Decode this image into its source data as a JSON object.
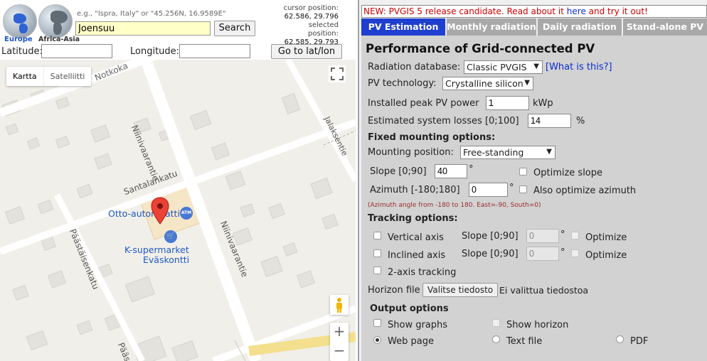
{
  "globes": [
    {
      "label": "Europe",
      "color": "#1a56c7"
    },
    {
      "label": "Africa-Asia",
      "color": "#333333"
    }
  ],
  "search": {
    "hint": "e.g., \"Ispra, Italy\" or \"45.256N, 16.9589E\"",
    "value": "Joensuu",
    "button": "Search"
  },
  "coords": {
    "cursor_label": "cursor position:",
    "cursor_value": "62.586, 29.796",
    "selected_label": "selected position:",
    "selected_value": "62.585, 29.793"
  },
  "latlon": {
    "lat_label": "Latitude:",
    "lon_label": "Longitude:",
    "goto_button": "Go to lat/lon"
  },
  "map": {
    "type_map": "Kartta",
    "type_satellite": "Satelliitti",
    "zoom_in": "+",
    "zoom_out": "−",
    "streets": {
      "notkokatu": "Notkoka",
      "niinivaarantie1": "Niinivaarantie",
      "niinivaarantie2": "Niinivaarantie",
      "jalaksentie": "Jalaksentie",
      "santalankatu": "Santalankatu",
      "paastaisenkatu": "Päästäisenkatu",
      "paasta": "Pääs"
    },
    "pois": {
      "otto": "Otto-automaatti",
      "ksupermarket_line1": "K-supermarket",
      "ksupermarket_line2": "Eväskontti",
      "atm": "ATM"
    }
  },
  "panel": {
    "news_prefix": "NEW: PVGIS 5 release candidate. Read about it ",
    "news_link": "here",
    "news_suffix": " and try it out!",
    "tabs": [
      "PV Estimation",
      "Monthly radiation",
      "Daily radiation",
      "Stand-alone PV"
    ],
    "title": "Performance of Grid-connected PV",
    "radiation_db_label": "Radiation database:",
    "radiation_db_value": "Classic PVGIS",
    "what_is_this": "[What is this?]",
    "pv_tech_label": "PV technology:",
    "pv_tech_value": "Crystalline silicon",
    "peak_power_label": "Installed peak PV power",
    "peak_power_value": "1",
    "peak_power_unit": "kWp",
    "losses_label": "Estimated system losses [0;100]",
    "losses_value": "14",
    "losses_unit": "%",
    "fixed_heading": "Fixed mounting options:",
    "mounting_label": "Mounting position:",
    "mounting_value": "Free-standing",
    "slope_label": "Slope [0;90]",
    "slope_value": "40",
    "deg": "°",
    "optimize_slope": "Optimize slope",
    "azimuth_label": "Azimuth [-180;180]",
    "azimuth_value": "0",
    "optimize_azimuth": "Also optimize azimuth",
    "azimuth_note": "(Azimuth angle from -180 to 180. East=-90, South=0)",
    "tracking_heading": "Tracking options:",
    "vertical_axis": "Vertical axis",
    "inclined_axis": "Inclined axis",
    "two_axis": "2-axis tracking",
    "track_slope_label": "Slope [0;90]",
    "track_slope_value": "0",
    "optimize": "Optimize",
    "horizon_label": "Horizon file",
    "horizon_button": "Valitse tiedosto",
    "horizon_status": "Ei valittua tiedostoa",
    "output_heading": "Output options",
    "show_graphs": "Show graphs",
    "show_horizon": "Show horizon",
    "web_page": "Web page",
    "text_file": "Text file",
    "pdf": "PDF"
  }
}
